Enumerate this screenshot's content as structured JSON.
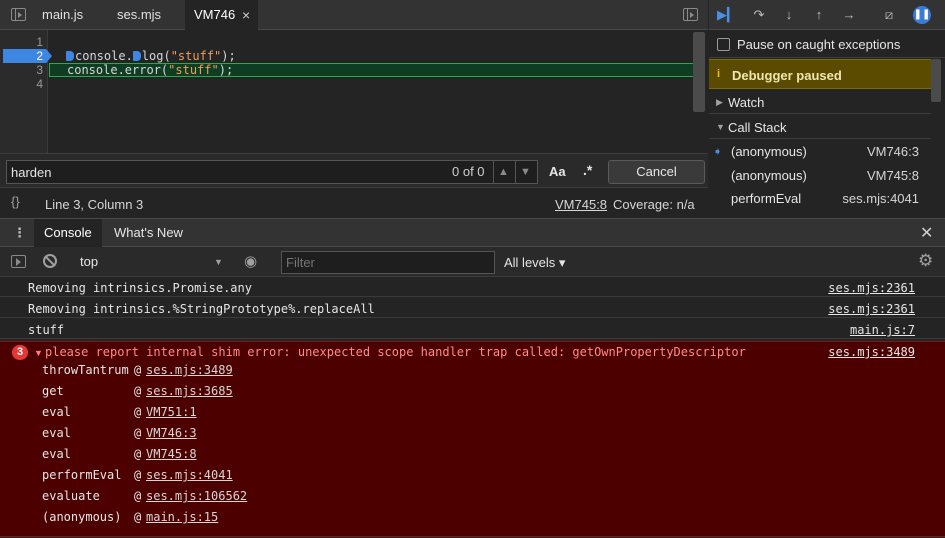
{
  "editor": {
    "tabs": [
      {
        "label": "main.js",
        "active": false
      },
      {
        "label": "ses.mjs",
        "active": false
      },
      {
        "label": "VM746",
        "active": true
      }
    ],
    "close_glyph": "×",
    "line_numbers": [
      "1",
      "2",
      "3",
      "4"
    ],
    "lines": {
      "l2_a": "console.",
      "l2_b": "log(",
      "l2_str": "\"stuff\"",
      "l2_c": ");",
      "l3_a": "console.error(",
      "l3_str": "\"stuff\"",
      "l3_c": ");"
    }
  },
  "search": {
    "value": "harden",
    "count": "0 of 0",
    "up_arrow": "▲",
    "down_arrow": "▼",
    "match_case": "Aa",
    "regex": ".*",
    "cancel": "Cancel"
  },
  "status": {
    "pretty_print": "{}",
    "cursor": "Line 3, Column 3",
    "file": "VM745:8",
    "coverage": "Coverage: n/a"
  },
  "debugger": {
    "pause_caught": "Pause on caught exceptions",
    "paused_icon": "i",
    "paused": "Debugger paused",
    "watch": "Watch",
    "call_stack": "Call Stack",
    "frames": [
      {
        "name": "(anonymous)",
        "loc": "VM746:3"
      },
      {
        "name": "(anonymous)",
        "loc": "VM745:8"
      },
      {
        "name": "performEval",
        "loc": "ses.mjs:4041"
      }
    ]
  },
  "drawer": {
    "menu_glyph": "⋮",
    "tabs": [
      "Console",
      "What's New"
    ],
    "close_glyph": "✕"
  },
  "console_toolbar": {
    "context": "top",
    "filter_placeholder": "Filter",
    "levels": "All levels ▾"
  },
  "messages": [
    {
      "text": "Removing intrinsics.Promise.any",
      "src": "ses.mjs:2361"
    },
    {
      "text": "Removing intrinsics.%StringPrototype%.replaceAll",
      "src": "ses.mjs:2361"
    },
    {
      "text": "stuff",
      "src": "main.js:7"
    }
  ],
  "error": {
    "count": "3",
    "text": "please report internal shim error: unexpected scope handler trap called: getOwnPropertyDescriptor",
    "src": "ses.mjs:3489",
    "at_glyph": "@",
    "stack": [
      {
        "fn": "throwTantrum",
        "loc": "ses.mjs:3489"
      },
      {
        "fn": "get",
        "loc": "ses.mjs:3685"
      },
      {
        "fn": "eval",
        "loc": "VM751:1"
      },
      {
        "fn": "eval",
        "loc": "VM746:3"
      },
      {
        "fn": "eval",
        "loc": "VM745:8"
      },
      {
        "fn": "performEval",
        "loc": "ses.mjs:4041"
      },
      {
        "fn": "evaluate",
        "loc": "ses.mjs:106562"
      },
      {
        "fn": "(anonymous)",
        "loc": "main.js:15"
      }
    ]
  },
  "colors": {
    "accent": "#3d86e1",
    "error_bg": "#4d0000",
    "paused_bg": "#5a4b00",
    "string": "#ee9e5e"
  }
}
